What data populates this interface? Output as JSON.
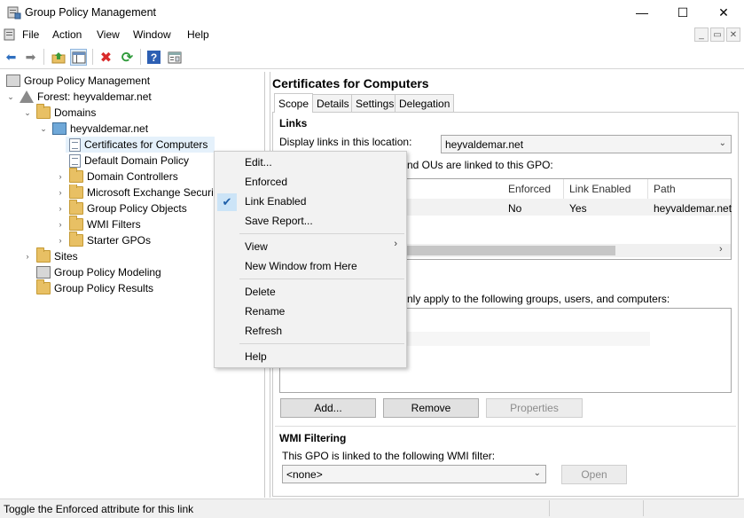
{
  "window": {
    "title": "Group Policy Management",
    "minimize_glyph": "—",
    "maximize_glyph": "☐",
    "close_glyph": "✕"
  },
  "menubar": {
    "items": [
      "File",
      "Action",
      "View",
      "Window",
      "Help"
    ],
    "mdi_minimize": "_",
    "mdi_restore": "▭",
    "mdi_close": "✕"
  },
  "toolbar": {
    "icons": [
      "back-arrow-icon",
      "forward-arrow-icon",
      "up-folder-icon",
      "show-hide-console-tree-icon",
      "delete-icon",
      "refresh-icon",
      "help-icon",
      "properties-icon"
    ],
    "back_glyph": "⬅",
    "forward_glyph": "➡",
    "delete_glyph": "✖",
    "refresh_glyph": "⟳",
    "help_glyph": "?"
  },
  "tree": {
    "root": "Group Policy Management",
    "forest": "Forest: heyvaldemar.net",
    "domains": "Domains",
    "domain": "heyvaldemar.net",
    "items": [
      "Certificates for Computers",
      "Default Domain Policy",
      "Domain Controllers",
      "Microsoft Exchange Securi",
      "Group Policy Objects",
      "WMI Filters",
      "Starter GPOs"
    ],
    "sites": "Sites",
    "modeling": "Group Policy Modeling",
    "results": "Group Policy Results"
  },
  "gpo": {
    "title": "Certificates for Computers",
    "tabs": [
      "Scope",
      "Details",
      "Settings",
      "Delegation"
    ],
    "active_tab": "Scope",
    "links": {
      "section_title": "Links",
      "display_label": "Display links in this location:",
      "location_value": "heyvaldemar.net",
      "linked_text": "nd OUs are linked to this GPO:",
      "columns": [
        "Enforced",
        "Link Enabled",
        "Path"
      ],
      "row": {
        "enforced": "No",
        "link_enabled": "Yes",
        "path": "heyvaldemar.net"
      }
    },
    "security_filtering": {
      "apply_text": "nly apply to the following groups, users, and computers:",
      "add_button": "Add...",
      "remove_button": "Remove",
      "properties_button": "Properties"
    },
    "wmi": {
      "section_title": "WMI Filtering",
      "label": "This GPO is linked to the following WMI filter:",
      "value": "<none>",
      "open_button": "Open"
    }
  },
  "context_menu": {
    "items": [
      {
        "label": "Edit..."
      },
      {
        "label": "Enforced"
      },
      {
        "label": "Link Enabled",
        "checked": true
      },
      {
        "label": "Save Report..."
      },
      {
        "label": "View",
        "submenu": true
      },
      {
        "label": "New Window from Here"
      },
      {
        "label": "Delete"
      },
      {
        "label": "Rename"
      },
      {
        "label": "Refresh"
      },
      {
        "label": "Help"
      }
    ],
    "check_glyph": "✔",
    "submenu_glyph": "›"
  },
  "status": {
    "text": "Toggle the Enforced attribute for this link"
  },
  "colors": {
    "selection": "#e5f1fb",
    "check_highlight": "#cce4f7",
    "menu_bg": "#f2f2f2",
    "accent": "#1f5fa8"
  }
}
